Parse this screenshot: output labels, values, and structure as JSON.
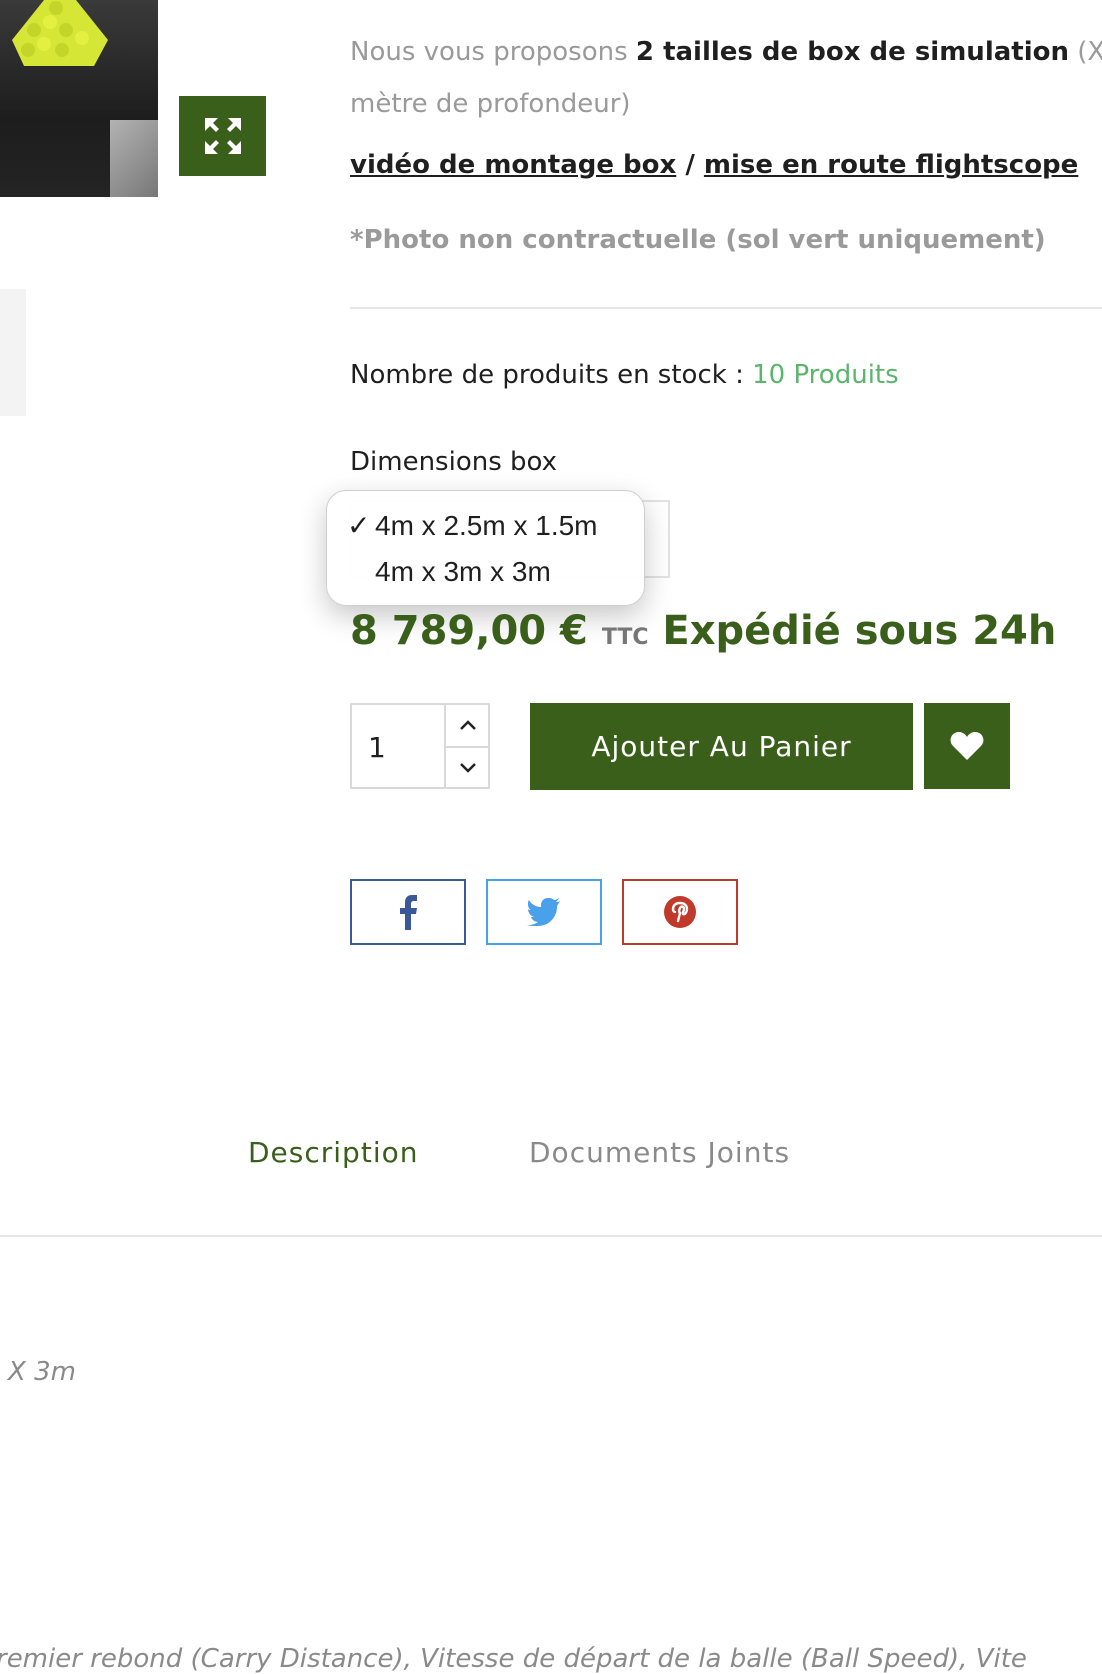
{
  "product": {
    "intro_prefix": "Nous vous proposons ",
    "intro_bold": "2 tailles de box de simulation",
    "intro_suffix": " (X",
    "intro_line2": "mètre de profondeur)",
    "link_montage": "vidéo de montage box",
    "link_separator": " / ",
    "link_flightscope": "mise en route flightscope ",
    "note": "*Photo non contractuelle (sol vert uniquement)",
    "stock_label": "Nombre de produits en stock : ",
    "stock_value": "10 Produits",
    "dimension_label": "Dimensions box",
    "dimension_options": [
      {
        "label": "4m x 2.5m x 1.5m",
        "selected": true
      },
      {
        "label": "4m x 3m x 3m",
        "selected": false
      }
    ],
    "check_glyph": "✓",
    "price": "8 789,00 €",
    "price_tax": "TTC",
    "shipping": "Expédié sous 24h",
    "quantity": "1",
    "add_to_cart": "Ajouter Au Panier"
  },
  "icons": {
    "expand": "expand-icon",
    "wishlist": "heart-icon",
    "qty_up": "chevron-up-icon",
    "qty_down": "chevron-down-icon",
    "facebook": "facebook-icon",
    "twitter": "twitter-icon",
    "pinterest": "pinterest-icon"
  },
  "tabs": [
    {
      "label": "Description",
      "active": true
    },
    {
      "label": "Documents Joints",
      "active": false
    }
  ],
  "description": {
    "fragment1": "X 3m",
    "fragment2": "remier rebond (Carry Distance), Vitesse de départ de la balle (Ball Speed), Vite"
  },
  "colors": {
    "brand_green": "#3a5f1b",
    "stock_green": "#5bb56d",
    "facebook": "#3b5998",
    "twitter": "#4aa1eb",
    "pinterest": "#c0392b"
  }
}
